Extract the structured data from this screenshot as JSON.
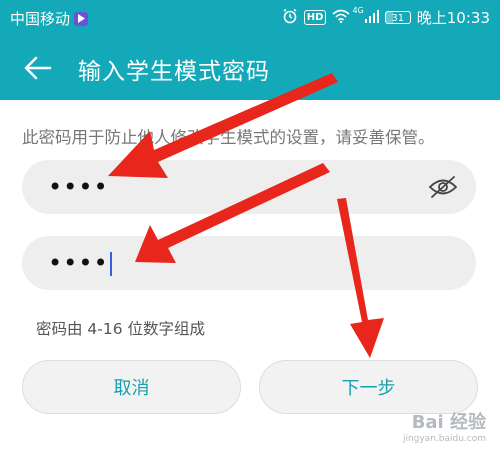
{
  "status_bar": {
    "carrier": "中国移动",
    "carrier_badge": "▷",
    "alarm_icon": "alarm-icon",
    "hd": "HD",
    "network": "4G",
    "battery": "31",
    "battery_level": 0.31,
    "time": "晚上10:33"
  },
  "header": {
    "back_icon": "back-arrow-icon",
    "title": "输入学生模式密码"
  },
  "main": {
    "description": "此密码用于防止他人修改学生模式的设置，请妥善保管。",
    "password_field": {
      "value": "••••",
      "toggle_icon": "eye-off-icon"
    },
    "confirm_field": {
      "value": "••••"
    },
    "hint": "密码由 4-16 位数字组成",
    "cancel_label": "取消",
    "next_label": "下一步"
  },
  "watermark": {
    "logo": "Bai 经验",
    "url": "jingyan.baidu.com"
  },
  "colors": {
    "accent": "#13a9b8",
    "button_text": "#1a9fae",
    "field_bg": "#eeeeee",
    "annotation_arrow": "#e8261b"
  }
}
